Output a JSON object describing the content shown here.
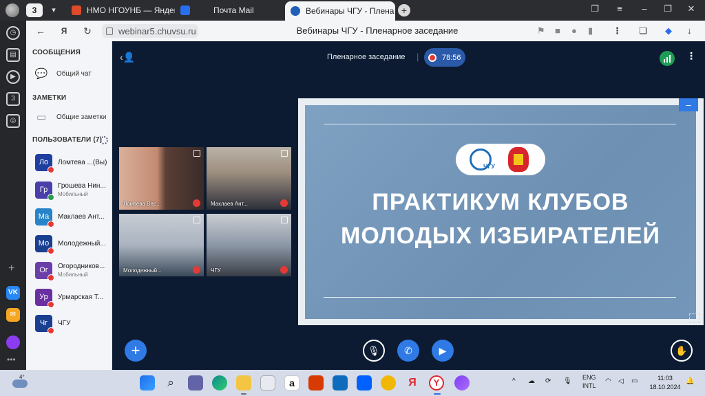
{
  "browser": {
    "tab_count": "3",
    "tabs": [
      {
        "title": "НМО НГОУНБ — Яндекс Г",
        "color": "#e04a2a"
      },
      {
        "title": "Почта Mail",
        "color": "#2a6ef0"
      },
      {
        "title": "Вебинары ЧГУ - Плена",
        "color": "#1e5fb8"
      }
    ],
    "url": "webinar5.chuvsu.ru",
    "page_title": "Вебинары ЧГУ - Пленарное заседание"
  },
  "panel": {
    "messages_title": "СООБЩЕНИЯ",
    "general_chat": "Общий чат",
    "notes_title": "ЗАМЕТКИ",
    "general_notes": "Общие заметки",
    "users_title": "ПОЛЬЗОВАТЕЛИ (7)",
    "users": [
      {
        "initials": "Ло",
        "name": "Ломтева ...(Вы)",
        "sub": "",
        "color": "#1f3fa0",
        "badge": "red"
      },
      {
        "initials": "Гр",
        "name": "Грошева Нин...",
        "sub": "Мобильный",
        "color": "#4a3fa8",
        "badge": "green"
      },
      {
        "initials": "Ма",
        "name": "Маклаев Ант...",
        "sub": "",
        "color": "#2784c8",
        "badge": "red"
      },
      {
        "initials": "Мо",
        "name": "Молодежный...",
        "sub": "",
        "color": "#1a3f91",
        "badge": "red"
      },
      {
        "initials": "Ог",
        "name": "Огородников...",
        "sub": "Мобильный",
        "color": "#6a3fa8",
        "badge": "red"
      },
      {
        "initials": "Ур",
        "name": "Урмарская Т...",
        "sub": "",
        "color": "#6a2fa0",
        "badge": "red"
      },
      {
        "initials": "Чг",
        "name": "ЧГУ",
        "sub": "",
        "color": "#1a3f91",
        "badge": "red"
      }
    ]
  },
  "stage": {
    "title": "Пленарное заседание",
    "timer": "78:56",
    "videos": [
      {
        "label": "Ломтева Вер..."
      },
      {
        "label": "Маклаев Ант..."
      },
      {
        "label": "Молодежный..."
      },
      {
        "label": "ЧГУ"
      }
    ],
    "slide": {
      "line1": "ПРАКТИКУМ  КЛУБОВ",
      "line2": "МОЛОДЫХ ИЗБИРАТЕЛЕЙ",
      "logo_text": "ЧГУ"
    }
  },
  "taskbar": {
    "temperature": "4°",
    "lang1": "ENG",
    "lang2": "INTL",
    "time": "11:03",
    "date": "18.10.2024"
  }
}
